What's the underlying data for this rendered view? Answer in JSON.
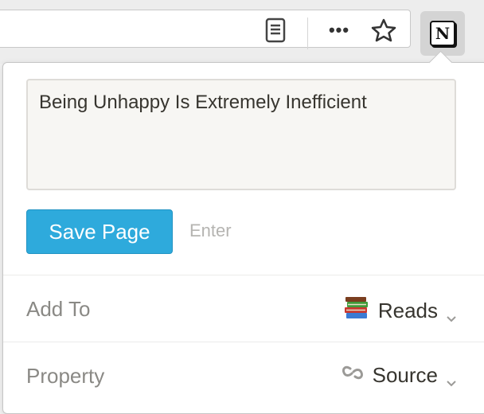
{
  "browser": {
    "reader_icon": "reader-view-icon",
    "more_icon": "more-horizontal-icon",
    "more_label": "•••",
    "bookmark_icon": "star-icon",
    "extension_icon": "notion-icon",
    "extension_logo_letter": "N"
  },
  "popup": {
    "page_title": "Being Unhappy Is Extremely Inefficient",
    "save_label": "Save Page",
    "enter_hint": "Enter",
    "add_to": {
      "label": "Add To",
      "value": "Reads",
      "icon": "books-icon"
    },
    "property": {
      "label": "Property",
      "value": "Source",
      "icon": "link-icon"
    }
  },
  "colors": {
    "accent": "#2eaadc",
    "text": "#37352f",
    "muted": "#8a8985"
  }
}
